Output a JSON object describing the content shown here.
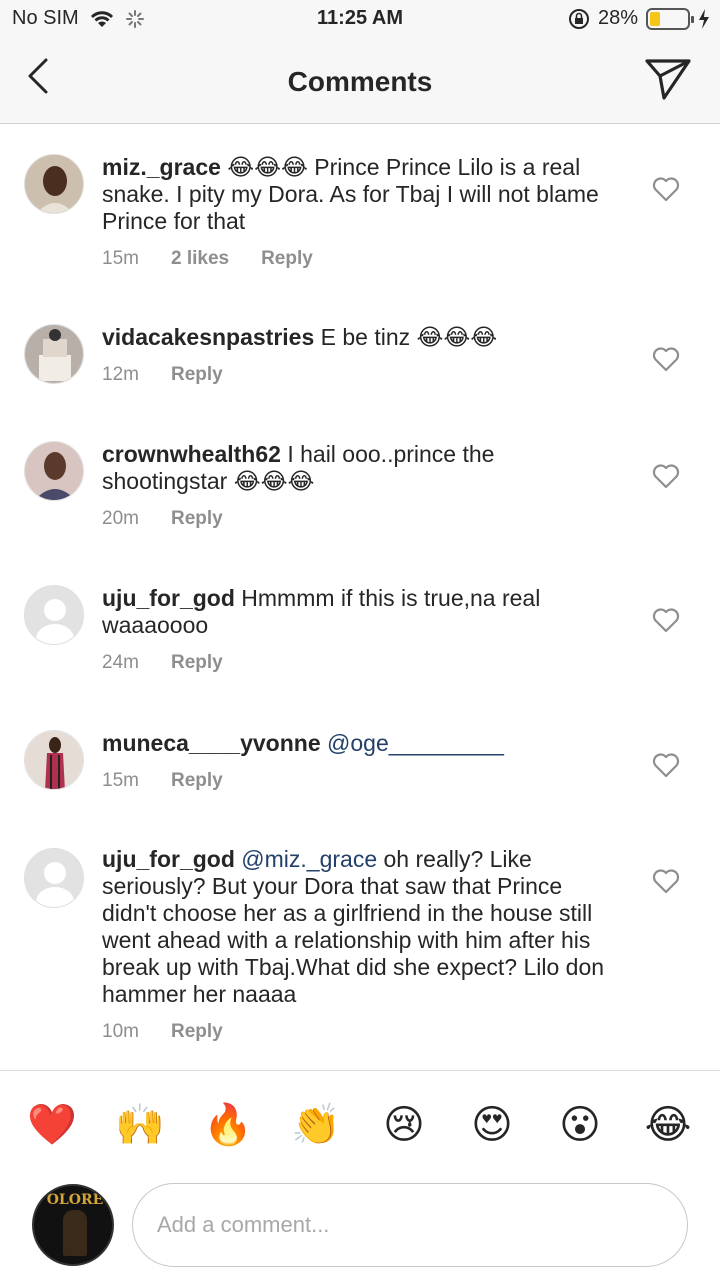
{
  "status_bar": {
    "carrier": "No SIM",
    "time": "11:25 AM",
    "battery": "28%",
    "battery_level": 0.28,
    "icons": [
      "wifi-icon",
      "loading-icon",
      "orientation-lock-icon",
      "battery-icon",
      "charging-icon"
    ]
  },
  "header": {
    "title": "Comments",
    "icons": [
      "chevron-left-icon",
      "send-icon"
    ]
  },
  "comments": [
    {
      "user": "miz._grace",
      "text": " 😂😂😂 Prince Prince Lilo is a real snake. I pity my Dora. As for Tbaj I will not blame Prince for that",
      "time": "15m",
      "likes": "2 likes",
      "reply": "Reply"
    },
    {
      "user": "vidacakesnpastries",
      "text": " E be tinz 😂😂😂",
      "time": "12m",
      "reply": "Reply"
    },
    {
      "user": "crownwhealth62",
      "text": " I hail ooo..prince the shootingstar 😂😂😂",
      "time": "20m",
      "reply": "Reply"
    },
    {
      "user": "uju_for_god",
      "text": " Hmmmm if this is true,na real waaaoooo",
      "time": "24m",
      "reply": "Reply"
    },
    {
      "user": "muneca____yvonne",
      "mention": " @oge_________",
      "text": "",
      "time": "15m",
      "reply": "Reply"
    },
    {
      "user": "uju_for_god",
      "mention": " @miz._grace",
      "text": " oh really? Like seriously? But your Dora that saw that Prince didn't choose her as a girlfriend in the house still went ahead with a relationship with him after his break up with Tbaj.What did she expect? Lilo don hammer her naaaa",
      "time": "10m",
      "reply": "Reply"
    }
  ],
  "reactions": [
    "❤️",
    "🙌",
    "🔥",
    "👏",
    "😢",
    "😍",
    "😮",
    "😂"
  ],
  "composer": {
    "placeholder": "Add a comment...",
    "avatar_text": "OLORE"
  },
  "colors": {
    "mention": "#23406b",
    "meta": "#8e8e8e",
    "battery": "#f5c518"
  }
}
